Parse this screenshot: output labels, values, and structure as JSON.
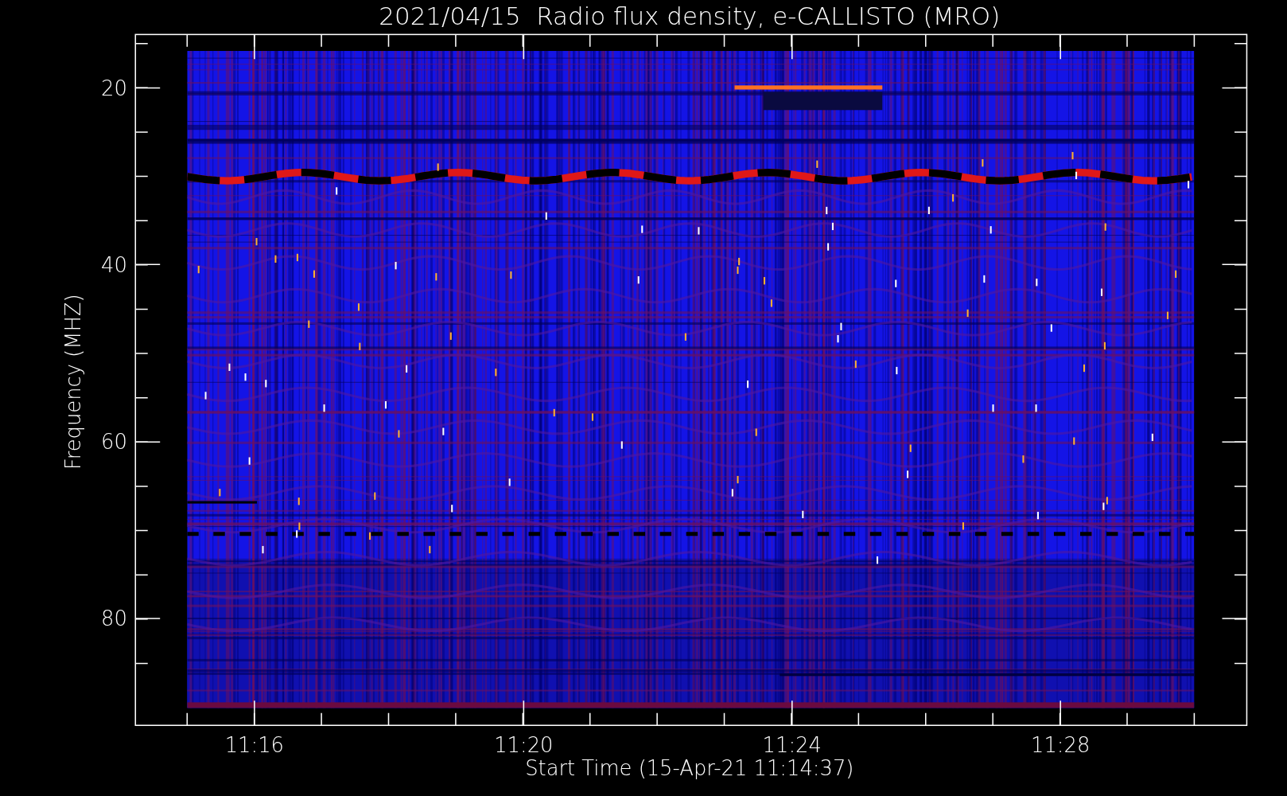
{
  "title": "2021/04/15  Radio flux density, e-CALLISTO (MRO)",
  "plot": {
    "y_axis": {
      "title": "Frequency (MHZ)",
      "tick_labels": [
        "20",
        "40",
        "60",
        "80"
      ]
    },
    "x_axis": {
      "title": "Start Time (15-Apr-21 11:14:37)",
      "tick_labels": [
        "11:16",
        "11:20",
        "11:24",
        "11:28"
      ]
    }
  }
}
